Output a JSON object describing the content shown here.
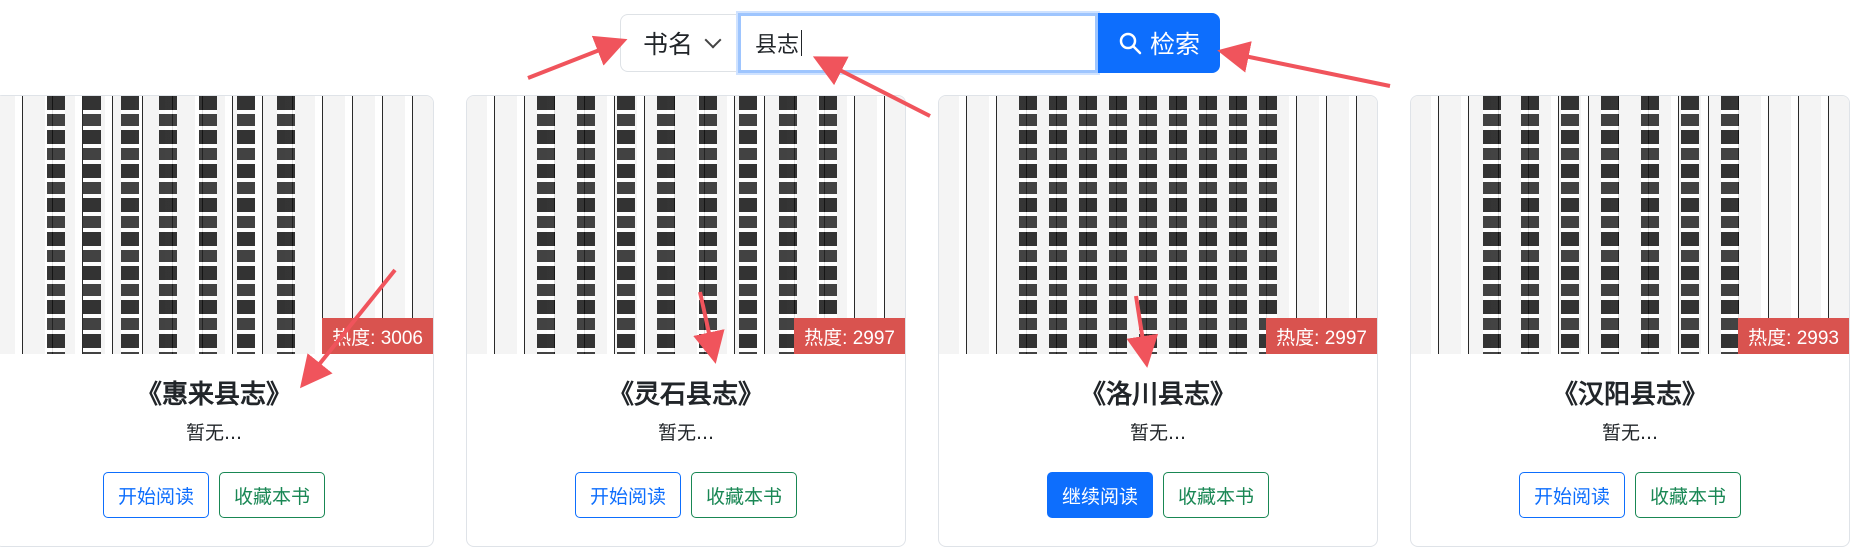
{
  "search": {
    "field_select": "书名",
    "query": "县志",
    "button_label": "检索"
  },
  "books": [
    {
      "title": "《惠来县志》",
      "desc": "暂无...",
      "heat": "热度: 3006",
      "read_label": "开始阅读",
      "fav_label": "收藏本书",
      "reading_in_progress": false
    },
    {
      "title": "《灵石县志》",
      "desc": "暂无...",
      "heat": "热度: 2997",
      "read_label": "开始阅读",
      "fav_label": "收藏本书",
      "reading_in_progress": false
    },
    {
      "title": "《洛川县志》",
      "desc": "暂无...",
      "heat": "热度: 2997",
      "read_label": "继续阅读",
      "fav_label": "收藏本书",
      "reading_in_progress": true
    },
    {
      "title": "《汉阳县志》",
      "desc": "暂无...",
      "heat": "热度: 2993",
      "read_label": "开始阅读",
      "fav_label": "收藏本书",
      "reading_in_progress": false
    }
  ],
  "icons": {
    "search_button": "search-icon",
    "select_arrow": "chevron-down-icon"
  },
  "colors": {
    "primary": "#0d6efd",
    "success": "#198754",
    "heat_badge": "#d9534f",
    "annotation_arrow": "#f0545c"
  }
}
